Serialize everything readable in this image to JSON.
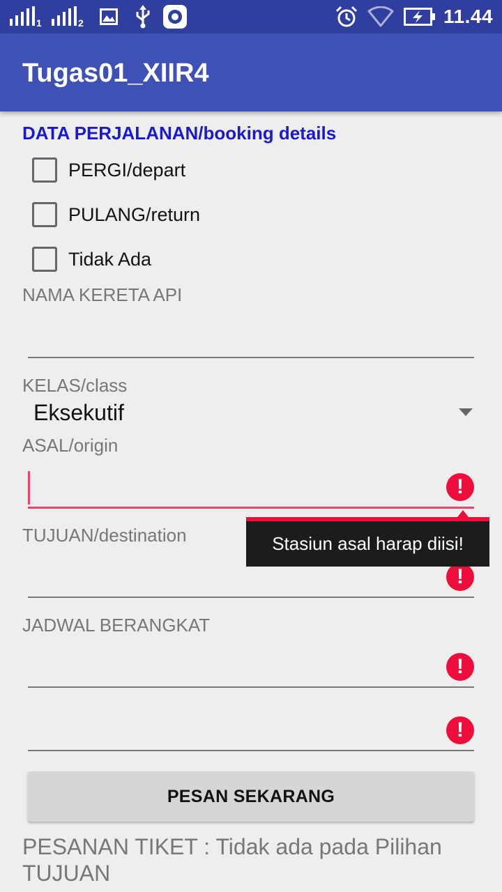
{
  "status_bar": {
    "sim1_label": "1",
    "sim2_label": "2",
    "icons": [
      "signal-icon",
      "signal-icon",
      "image-icon",
      "usb-icon",
      "screen-record-icon",
      "alarm-icon",
      "wifi-icon",
      "battery-charging-icon"
    ],
    "time": "11.44"
  },
  "app_bar": {
    "title": "Tugas01_XIIR4"
  },
  "form": {
    "section_title": "DATA PERJALANAN/booking details",
    "checkboxes": [
      {
        "label": "PERGI/depart",
        "checked": false
      },
      {
        "label": "PULANG/return",
        "checked": false
      },
      {
        "label": "Tidak Ada",
        "checked": false
      }
    ],
    "train_name": {
      "label": "NAMA KERETA API",
      "value": ""
    },
    "class": {
      "label": "KELAS/class",
      "selected": "Eksekutif"
    },
    "origin": {
      "label": "ASAL/origin",
      "value": "",
      "error": "Stasiun asal harap diisi!"
    },
    "destination": {
      "label": "TUJUAN/destination",
      "value": ""
    },
    "schedule": {
      "label": "JADWAL BERANGKAT",
      "value": ""
    },
    "extra": {
      "value": ""
    },
    "error_icon_glyph": "!",
    "submit_label": "PESAN SEKARANG",
    "result_text": "PESANAN TIKET : Tidak ada pada Pilihan TUJUAN"
  },
  "colors": {
    "status_bar": "#303f9f",
    "app_bar": "#3f51b5",
    "section_title": "#1a1acc",
    "error": "#ee0e3c",
    "background": "#eeeeee"
  }
}
